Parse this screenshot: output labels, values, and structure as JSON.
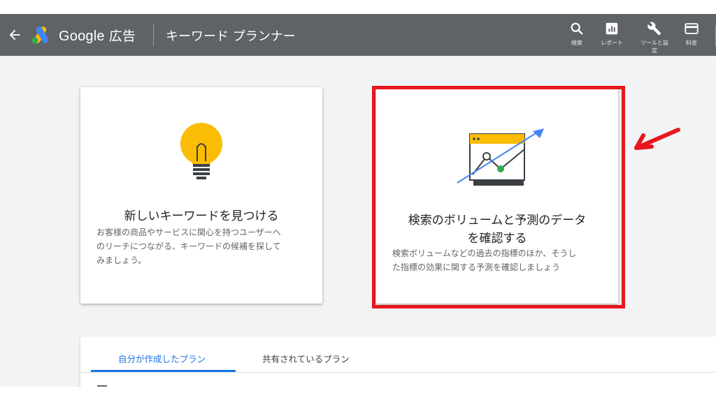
{
  "header": {
    "brand_google": "Google",
    "brand_ads": "広告",
    "app_title": "キーワード プランナー",
    "bg_color": "#5f6368",
    "tools": [
      {
        "label": "検索",
        "icon": "search-icon"
      },
      {
        "label": "レポート",
        "icon": "report-icon"
      },
      {
        "label": "ツールと設定",
        "icon": "wrench-icon"
      },
      {
        "label": "料金",
        "icon": "billing-card-icon"
      }
    ]
  },
  "cards": [
    {
      "title": "新しいキーワードを見つける",
      "description_lines": [
        "お客様の商品やサービスに関心を持つユーザーへ",
        "のリーチにつながる、キーワードの候補を探して",
        "みましょう。"
      ],
      "icon": "lightbulb-icon"
    },
    {
      "title_lines": [
        "検索のボリュームと予測のデータ",
        "を確認する"
      ],
      "description_lines": [
        "検索ボリュームなどの過去の指標のほか、そうし",
        "た指標の効果に関する予測を確認しましょう"
      ],
      "icon": "trend-chart-icon"
    }
  ],
  "annotation": {
    "highlight_color": "#e8171c"
  },
  "plans": {
    "tabs": [
      {
        "label": "自分が作成したプラン",
        "active": true
      },
      {
        "label": "共有されているプラン",
        "active": false
      }
    ],
    "accent_color": "#1a73e8"
  }
}
